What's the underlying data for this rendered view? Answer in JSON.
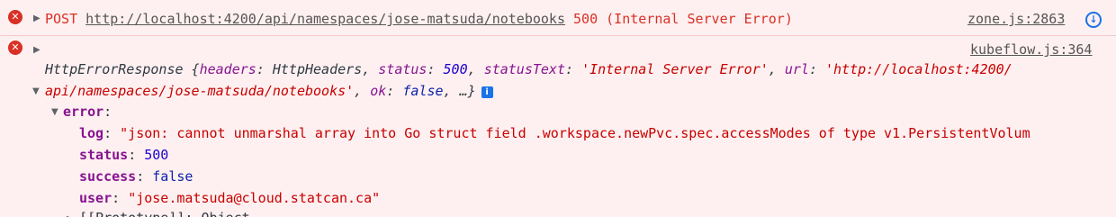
{
  "colors": {
    "error_background": "#fef0f0",
    "error_text": "#d93025",
    "key": "#881391",
    "string": "#c80000",
    "number": "#1c00cf",
    "keyword": "#0d22aa",
    "link_icon": "#1a73e8"
  },
  "messages": [
    {
      "icon": "error-circle-icon",
      "method": "POST",
      "url": "http://localhost:4200/api/namespaces/jose-matsuda/notebooks",
      "status_text": "500 (Internal Server Error)",
      "source": "zone.js:2863",
      "network_icon": "network-panel-icon"
    },
    {
      "icon": "error-circle-icon",
      "source": "kubeflow.js:364",
      "object_type": "HttpErrorResponse",
      "headers_key": "headers",
      "headers_value": "HttpHeaders",
      "status_key": "status",
      "status_value": "500",
      "statusText_key": "statusText",
      "statusText_value": "'Internal Server Error'",
      "url_key": "url",
      "url_value_part1": "'http://localhost:4200/",
      "url_value_part2": "api/namespaces/jose-matsuda/notebooks'",
      "ok_key": "ok",
      "ok_value": "false",
      "ellipsis": "…}",
      "info_icon_label": "i",
      "error_key": "error",
      "error_fields": [
        {
          "key": "log",
          "value": "\"json: cannot unmarshal array into Go struct field .workspace.newPvc.spec.accessModes of type v1.PersistentVolum"
        },
        {
          "key": "status",
          "value": "500"
        },
        {
          "key": "success",
          "value": "false"
        },
        {
          "key": "user",
          "value": "\"jose.matsuda@cloud.statcan.ca\""
        }
      ],
      "prototype_label": "[[Prototype]]: Object"
    }
  ]
}
